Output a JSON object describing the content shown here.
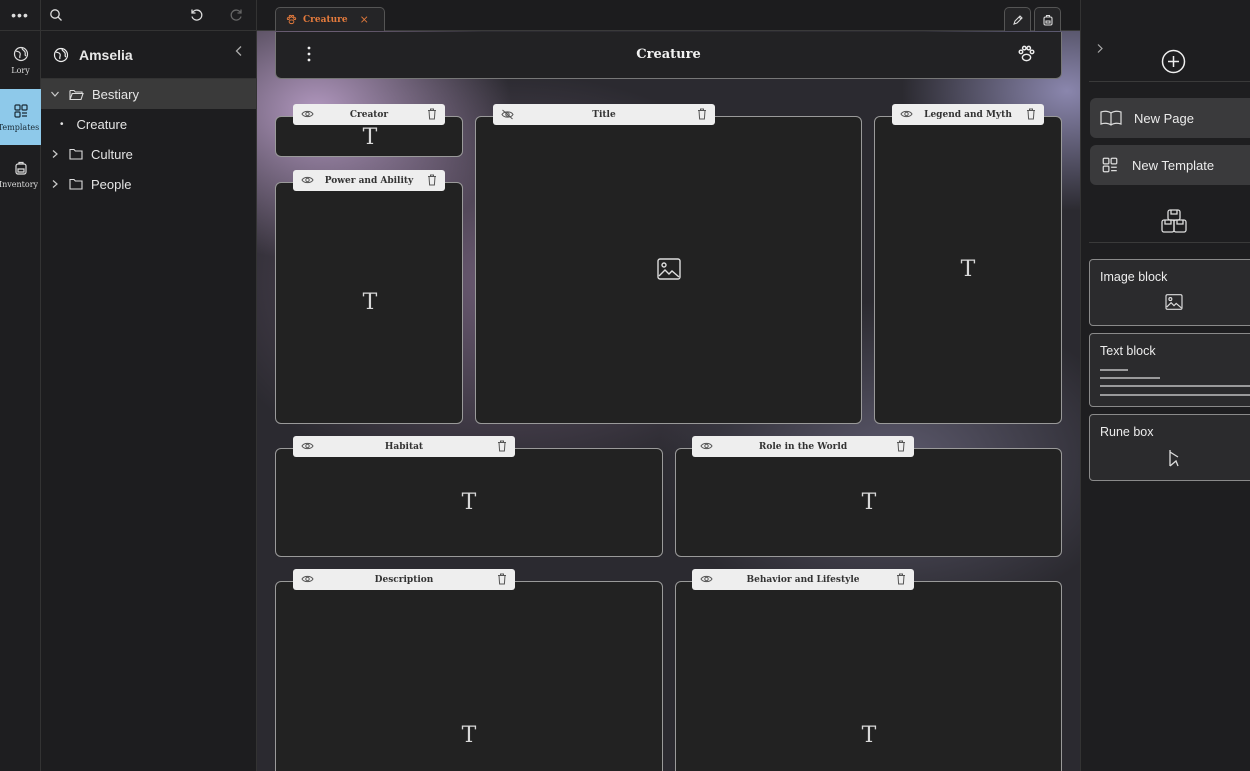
{
  "rail": {
    "dots": "•••",
    "items": [
      {
        "label": "Lory",
        "icon": "globe-icon"
      },
      {
        "label": "Templates",
        "icon": "templates-icon"
      },
      {
        "label": "Inventory",
        "icon": "backpack-icon"
      }
    ]
  },
  "sidebar": {
    "world_name": "Amselia",
    "tree": [
      {
        "label": "Bestiary",
        "type": "folder",
        "expanded": true
      },
      {
        "label": "Creature",
        "type": "page"
      },
      {
        "label": "Culture",
        "type": "folder",
        "expanded": false
      },
      {
        "label": "People",
        "type": "folder",
        "expanded": false
      }
    ]
  },
  "tab": {
    "label": "Creature",
    "close": "×"
  },
  "page": {
    "title": "Creature"
  },
  "blocks": {
    "creator": "Creator",
    "title": "Title",
    "legend": "Legend and Myth",
    "power": "Power and Ability",
    "habitat": "Habitat",
    "role": "Role in the World",
    "description": "Description",
    "behavior": "Behavior and Lifestyle"
  },
  "text_glyph": "T",
  "right": {
    "new_page": "New Page",
    "new_template": "New Template",
    "image_block": "Image block",
    "text_block": "Text block",
    "rune_box": "Rune box"
  },
  "colors": {
    "accent": "#e47a3c",
    "rail_active": "#8ec9ea",
    "block_header": "#eeeeee"
  }
}
